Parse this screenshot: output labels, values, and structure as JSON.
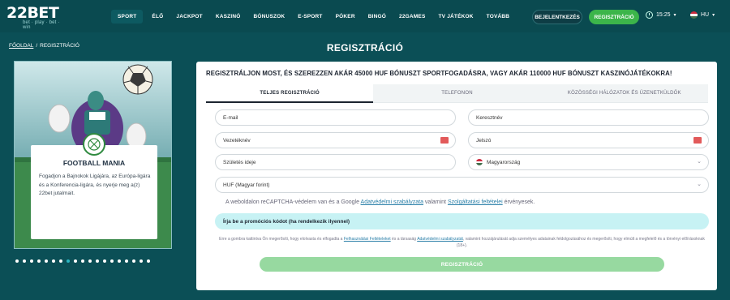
{
  "header": {
    "logo_text": "22BET",
    "logo_sub": "bet · play · bet · win",
    "nav": [
      {
        "label": "SPORT",
        "boxed": true
      },
      {
        "label": "ÉLŐ",
        "boxed": false
      },
      {
        "label": "JACKPOT",
        "boxed": false
      },
      {
        "label": "KASZINÓ",
        "boxed": false
      },
      {
        "label": "BÓNUSZOK",
        "boxed": false
      },
      {
        "label": "E-SPORT",
        "boxed": false
      },
      {
        "label": "PÓKER",
        "boxed": false
      },
      {
        "label": "BINGÓ",
        "boxed": false
      },
      {
        "label": "22GAMES",
        "boxed": false
      },
      {
        "label": "TV JÁTÉKOK",
        "boxed": false
      },
      {
        "label": "TOVÁBB",
        "boxed": false
      }
    ],
    "login_label": "BEJELENTKEZÉS",
    "register_label": "REGISZTRÁCIÓ",
    "time": "15:25",
    "lang": "HU",
    "accent": "#3cb54a"
  },
  "breadcrumb": {
    "home": "FŐOLDAL",
    "separator": "/",
    "current": "REGISZTRÁCIÓ"
  },
  "page_title": "REGISZTRÁCIÓ",
  "promo": {
    "title": "FOOTBALL MANIA",
    "text": "Fogadjon a Bajnokok Ligájára, az Európa-ligára és a Konferencia-ligára, és nyerje meg a(z) 22bet jutalmait.",
    "dots_total": 19,
    "dots_active_index": 7
  },
  "form": {
    "headline": "REGISZTRÁLJON MOST, ÉS SZEREZZEN AKÁR 45000 HUF BÓNUSZT SPORTFOGADÁSRA, VAGY AKÁR 110000 HUF BÓNUSZT KASZINÓJÁTÉKOKRA!",
    "tabs": [
      "TELJES REGISZTRÁCIÓ",
      "TELEFONON",
      "KÖZÖSSÉGI HÁLÓZATOK ÉS ÜZENETKÜLDŐK"
    ],
    "fields": {
      "email": "E-mail",
      "first_name": "Keresztnév",
      "last_name": "Vezetéknév",
      "password": "Jelszó",
      "birth_date": "Születés ideje",
      "country": "Magyarország",
      "currency": "HUF (Magyar forint)"
    },
    "captcha": {
      "prefix": "A weboldalon reCAPTCHA-védelem van és a Google ",
      "link1": "Adatvédelmi szabályzata",
      "mid": " valamint ",
      "link2": "Szolgáltatási feltételei",
      "suffix": " érvényesek."
    },
    "promo_code": "Írja be a promóciós kódot (ha rendelkezik ilyennel)",
    "legal": {
      "p1": "Erre a gombra kattintva Ön megerősíti, hogy elolvasta és elfogadta a ",
      "link1": "Felhasználási Feltételeket",
      "p2": " és a társaság ",
      "link2": "Adatvédelmi szabályzatát",
      "p3": ", valamint hozzájárulását adja személyes adatainak feldolgozásához és megerősíti, hogy elmúlt a megfelelő és a törvényi előírásoknak (18+)."
    },
    "submit_label": "REGISZTRÁCIÓ"
  }
}
